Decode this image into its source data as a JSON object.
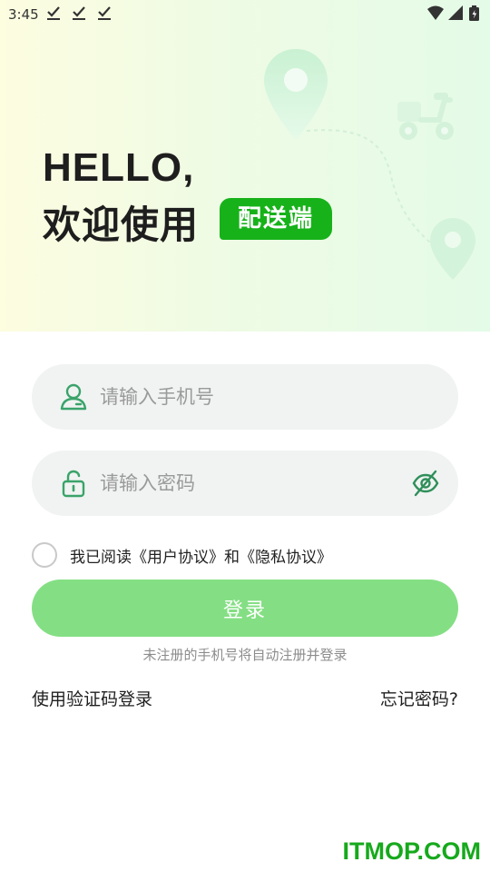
{
  "status_bar": {
    "time": "3:45",
    "icons": [
      "check-icon",
      "check-icon",
      "check-icon",
      "wifi-icon",
      "signal-icon",
      "battery-charging-icon"
    ]
  },
  "hero": {
    "greeting": "HELLO,",
    "welcome": "欢迎使用",
    "badge": "配送端",
    "decorations": [
      "location-pin-icon",
      "scooter-icon",
      "location-pin-icon"
    ]
  },
  "login_form": {
    "phone_placeholder": "请输入手机号",
    "phone_value": "",
    "password_placeholder": "请输入密码",
    "password_value": "",
    "agreement_text": "我已阅读《用户协议》和《隐私协议》",
    "login_label": "登录",
    "auto_register_note": "未注册的手机号将自动注册并登录",
    "sms_login_label": "使用验证码登录",
    "forgot_password_label": "忘记密码?"
  },
  "watermark": "ITMOP.COM",
  "colors": {
    "brand_green": "#17b21a",
    "login_button": "#84df84",
    "icon_green": "#3aa36a",
    "field_bg": "#f0f3f2"
  }
}
